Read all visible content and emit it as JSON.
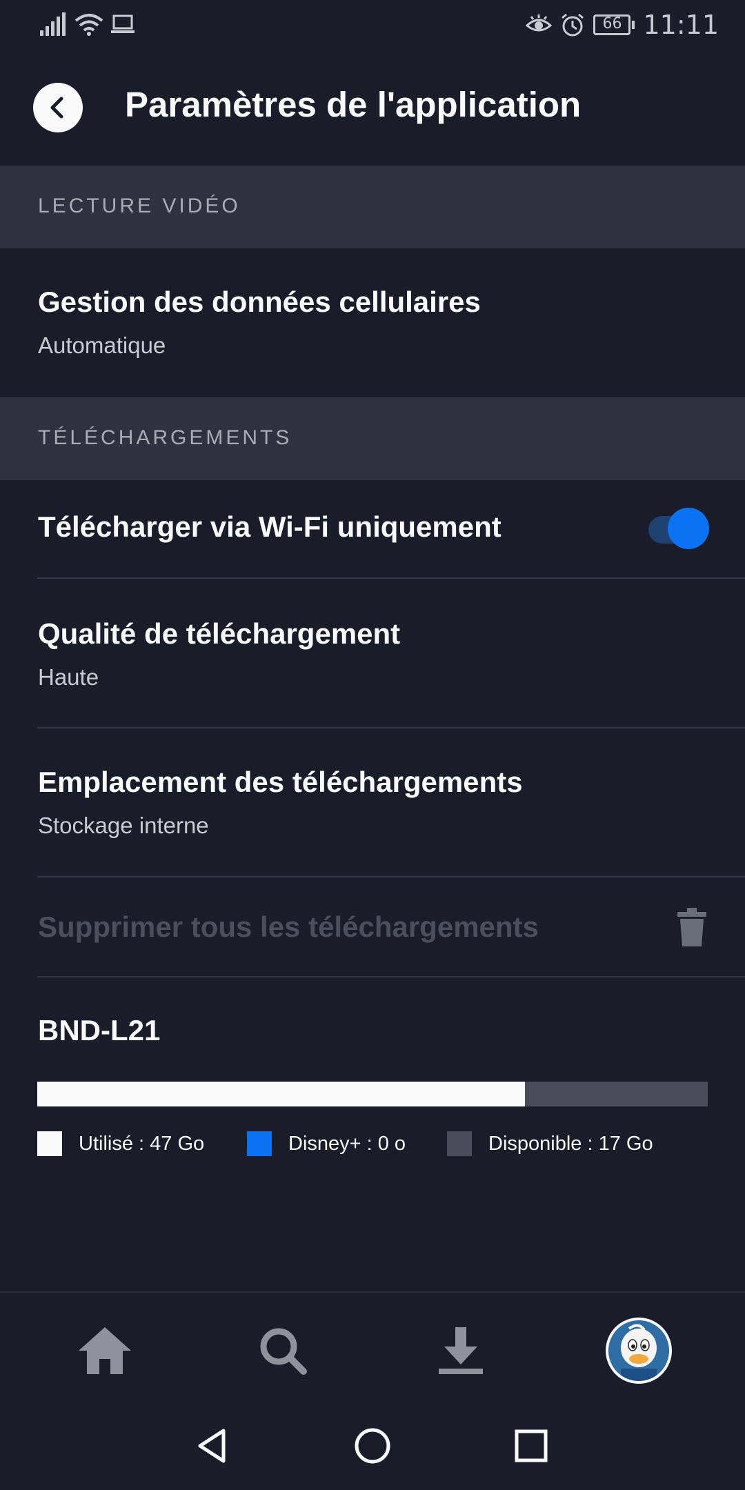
{
  "status_bar": {
    "time": "11:11",
    "battery": "66",
    "icons": [
      "signal-icon",
      "wifi-icon",
      "laptop-icon",
      "eye-icon",
      "alarm-icon",
      "battery-icon"
    ]
  },
  "header": {
    "title": "Paramètres de l'application",
    "back_icon": "chevron-left-icon"
  },
  "sections": {
    "playback": {
      "header": "LECTURE VIDÉO",
      "cellular": {
        "title": "Gestion des données cellulaires",
        "value": "Automatique"
      }
    },
    "downloads": {
      "header": "TÉLÉCHARGEMENTS",
      "wifi_only": {
        "title": "Télécharger via Wi-Fi uniquement",
        "enabled": true
      },
      "quality": {
        "title": "Qualité de téléchargement",
        "value": "Haute"
      },
      "location": {
        "title": "Emplacement des téléchargements",
        "value": "Stockage interne"
      },
      "delete_all": {
        "title": "Supprimer tous les téléchargements",
        "icon": "trash-icon"
      }
    }
  },
  "storage": {
    "device": "BND-L21",
    "used_fraction": 0.727,
    "legend": {
      "used": "Utilisé : 47 Go",
      "disney": "Disney+ : 0 o",
      "available": "Disponible : 17 Go"
    },
    "colors": {
      "used": "#f9f9f9",
      "disney": "#0a72f3",
      "available": "#4a4c5b"
    }
  },
  "bottom_nav": [
    "home-icon",
    "search-icon",
    "download-icon",
    "profile-avatar"
  ],
  "system_nav": [
    "back-triangle-icon",
    "home-circle-icon",
    "recents-square-icon"
  ],
  "colors": {
    "background": "#1a1c29",
    "section": "#2f3140",
    "accent": "#0a72f3"
  }
}
